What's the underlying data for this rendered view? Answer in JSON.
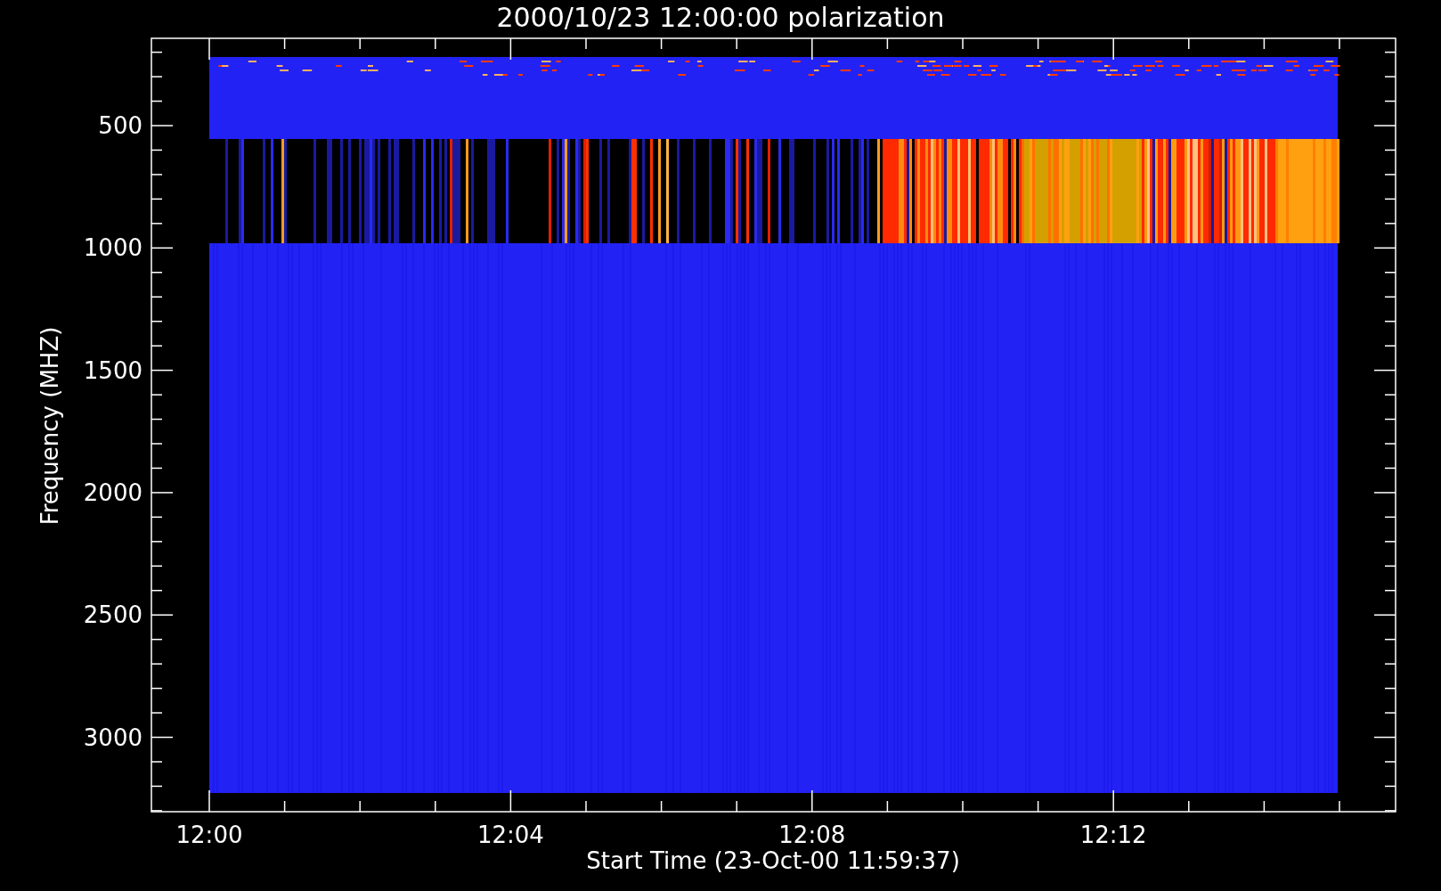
{
  "title": "2000/10/23 12:00:00 polarization",
  "plot": {
    "ylabel": "Frequency (MHZ)",
    "xlabel": "Start Time (23-Oct-00 11:59:37)",
    "yticks": [
      "500",
      "1000",
      "1500",
      "2000",
      "2500",
      "3000"
    ],
    "xticks": [
      "12:00",
      "12:04",
      "12:08",
      "12:12"
    ]
  }
}
